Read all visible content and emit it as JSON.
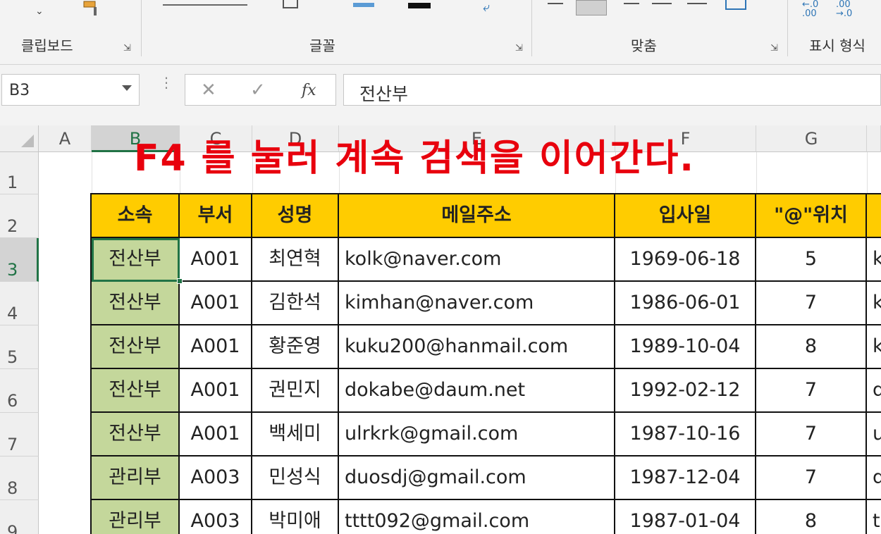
{
  "ribbon": {
    "groups": [
      {
        "label": "클립보드"
      },
      {
        "label": "글꼴"
      },
      {
        "label": "맞춤"
      },
      {
        "label": "표시 형식"
      }
    ]
  },
  "formula_bar": {
    "name_box": "B3",
    "cancel_icon": "✕",
    "enter_icon": "✓",
    "fx_icon": "fx",
    "formula": "전산부"
  },
  "overlay": {
    "text": "F4 를 눌러 계속 검색을 이어간다."
  },
  "columns": [
    "A",
    "B",
    "C",
    "D",
    "E",
    "F",
    "G"
  ],
  "rows": [
    "1",
    "2",
    "3",
    "4",
    "5",
    "6",
    "7",
    "8",
    "9"
  ],
  "table": {
    "headers": [
      "소속",
      "부서",
      "성명",
      "메일주소",
      "입사일",
      "\"@\"위치"
    ],
    "rows": [
      [
        "전산부",
        "A001",
        "최연혁",
        "kolk@naver.com",
        "1969-06-18",
        "5",
        "k"
      ],
      [
        "전산부",
        "A001",
        "김한석",
        "kimhan@naver.com",
        "1986-06-01",
        "7",
        "k"
      ],
      [
        "전산부",
        "A001",
        "황준영",
        "kuku200@hanmail.com",
        "1989-10-04",
        "8",
        "k"
      ],
      [
        "전산부",
        "A001",
        "권민지",
        "dokabe@daum.net",
        "1992-02-12",
        "7",
        "d"
      ],
      [
        "전산부",
        "A001",
        "백세미",
        "ulrkrk@gmail.com",
        "1987-10-16",
        "7",
        "u"
      ],
      [
        "관리부",
        "A003",
        "민성식",
        "duosdj@gmail.com",
        "1987-12-04",
        "7",
        "d"
      ],
      [
        "관리부",
        "A003",
        "박미애",
        "tttt092@gmail.com",
        "1987-01-04",
        "8",
        "t"
      ]
    ]
  },
  "colors": {
    "header_fill": "#ffcc00",
    "dept_fill": "#c4d79b",
    "selection": "#217346",
    "overlay_text": "#e8000d"
  }
}
